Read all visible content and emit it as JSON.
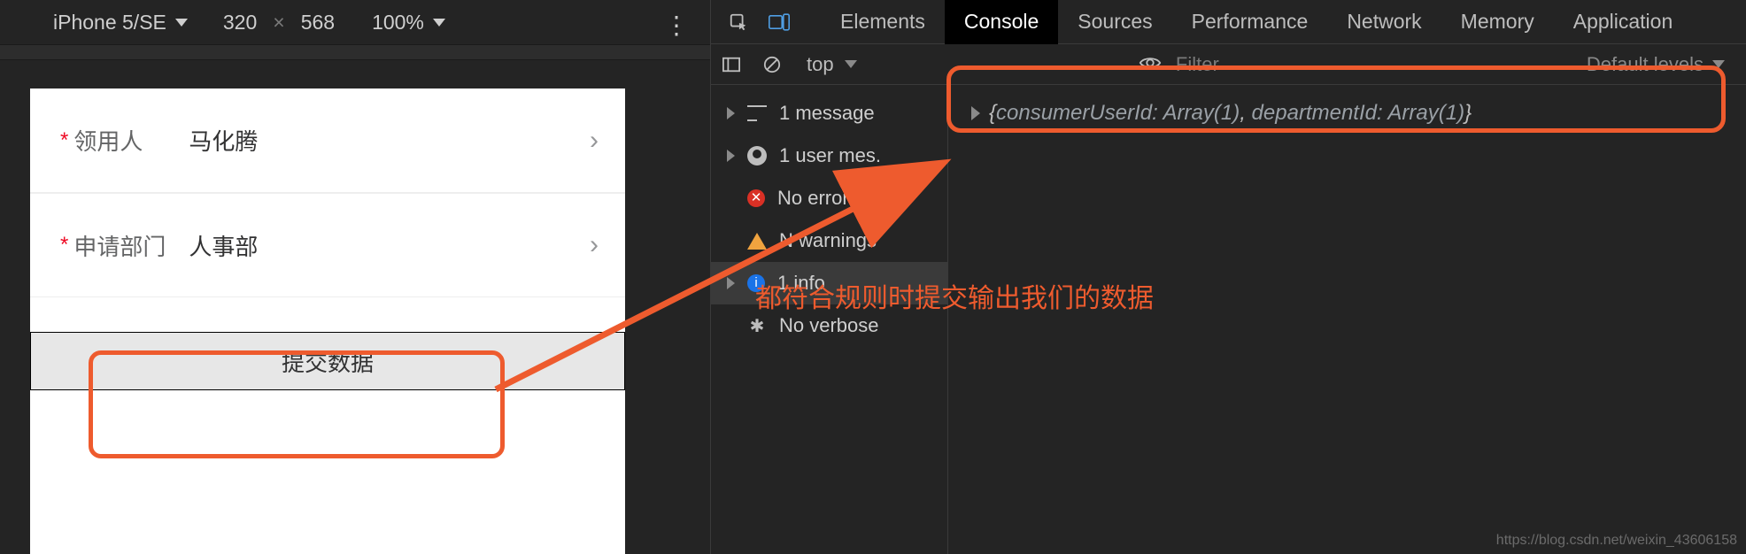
{
  "emulation": {
    "device": "iPhone 5/SE",
    "width": "320",
    "height": "568",
    "zoom": "100%"
  },
  "form": {
    "row1_label": "领用人",
    "row1_value": "马化腾",
    "row2_label": "申请部门",
    "row2_value": "人事部",
    "submit_label": "提交数据"
  },
  "devtools": {
    "tabs": {
      "elements": "Elements",
      "console": "Console",
      "sources": "Sources",
      "performance": "Performance",
      "network": "Network",
      "memory": "Memory",
      "application": "Application"
    },
    "subbar": {
      "context": "top",
      "filter_placeholder": "Filter",
      "levels": "Default levels"
    },
    "sidebar": {
      "messages": "1 message",
      "user_messages": "1 user mes.",
      "no_errors": "No error",
      "no_warnings": "N   warnings",
      "info": "1 info",
      "no_verbose": "No verbose"
    },
    "console_log": {
      "open_brace": "{",
      "prop1": "consumerUserId: ",
      "type1": "Array(1)",
      "comma": ", ",
      "prop2": "departmentId: ",
      "type2": "Array(1)",
      "close_brace": "}"
    }
  },
  "annotation": {
    "text": "都符合规则时提交输出我们的数据"
  },
  "watermark": "https://blog.csdn.net/weixin_43606158"
}
